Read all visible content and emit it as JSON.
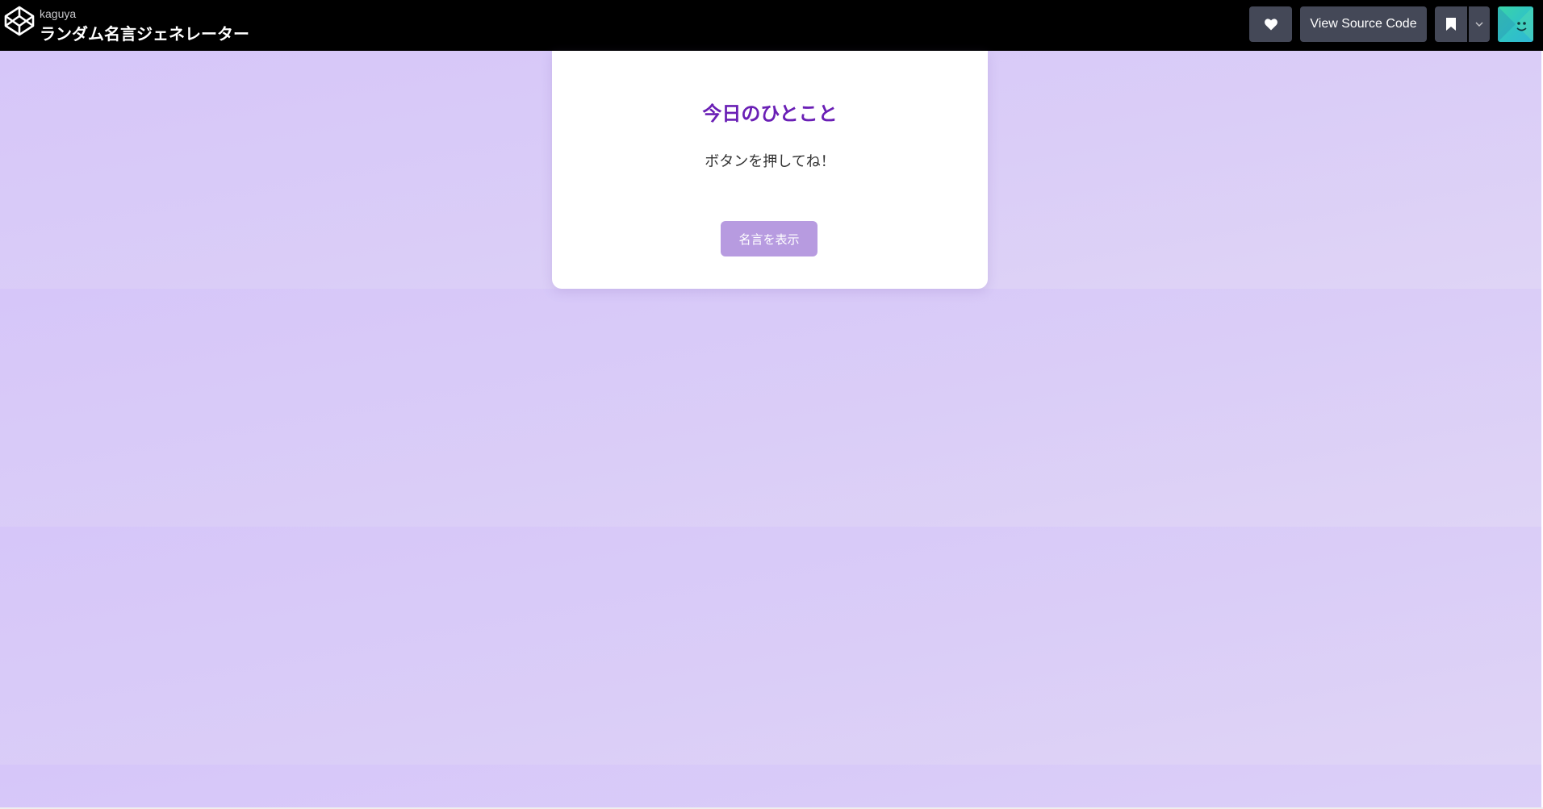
{
  "header": {
    "author": "kaguya",
    "title": "ランダム名言ジェネレーター",
    "logo_icon": "codepen-logo-icon",
    "buttons": {
      "heart_icon": "heart-icon",
      "view_source_label": "View Source Code",
      "bookmark_icon": "bookmark-icon",
      "caret_icon": "chevron-down-icon"
    },
    "avatar": "user-avatar"
  },
  "card": {
    "title": "今日のひとこと",
    "quote": "ボタンを押してね！",
    "button_label": "名言を表示"
  },
  "colors": {
    "topbar": "#000000",
    "header_button": "#444857",
    "background": "#d8cbf8",
    "card_title": "#6a1fb5",
    "show_button": "#b79be0"
  }
}
